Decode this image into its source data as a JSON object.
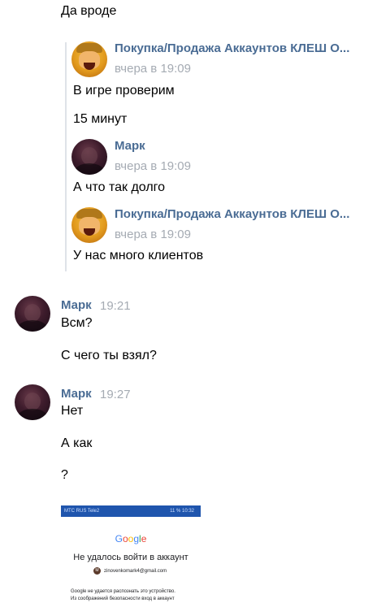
{
  "top_message": {
    "text": "Да вроде"
  },
  "forwarded": {
    "items": [
      {
        "author": "Покупка/Продажа Аккаунтов КЛЕШ О...",
        "time": "вчера в 19:09",
        "avatar": "clash-of-clans-barbarian-avatar",
        "lines": [
          "В игре проверим",
          "15 минут"
        ]
      },
      {
        "author": "Марк",
        "time": "вчера в 19:09",
        "avatar": "user-photo-avatar",
        "lines": [
          "А что так долго"
        ]
      },
      {
        "author": "Покупка/Продажа Аккаунтов КЛЕШ О...",
        "time": "вчера в 19:09",
        "avatar": "clash-of-clans-barbarian-avatar",
        "lines": [
          "У нас много клиентов"
        ]
      }
    ]
  },
  "messages": [
    {
      "author": "Марк",
      "time": "19:21",
      "avatar": "user-photo-avatar",
      "lines": [
        "Всм?",
        "С чего ты взял?"
      ]
    },
    {
      "author": "Марк",
      "time": "19:27",
      "avatar": "user-photo-avatar",
      "lines": [
        "Нет",
        "А как",
        "?"
      ]
    }
  ],
  "attachment": {
    "status_left": "МТС RUS\nTele2",
    "status_right": "11 % 10:32",
    "google_letters": [
      "G",
      "o",
      "o",
      "g",
      "l",
      "e"
    ],
    "google_colors": [
      "#4285F4",
      "#EA4335",
      "#FBBC05",
      "#4285F4",
      "#34A853",
      "#EA4335"
    ],
    "title": "Не удалось войти в аккаунт",
    "account_initial": "M",
    "account_email": "zinovenkomark4@gmail.com",
    "desc_line1": "Google не удается распознать это устройство.",
    "desc_line2": "Из соображений безопасности вход в аккаунт"
  },
  "colors": {
    "author_name": "#4a6c94",
    "timestamp": "#a5abb3",
    "forward_bar": "#dfe3e8"
  }
}
